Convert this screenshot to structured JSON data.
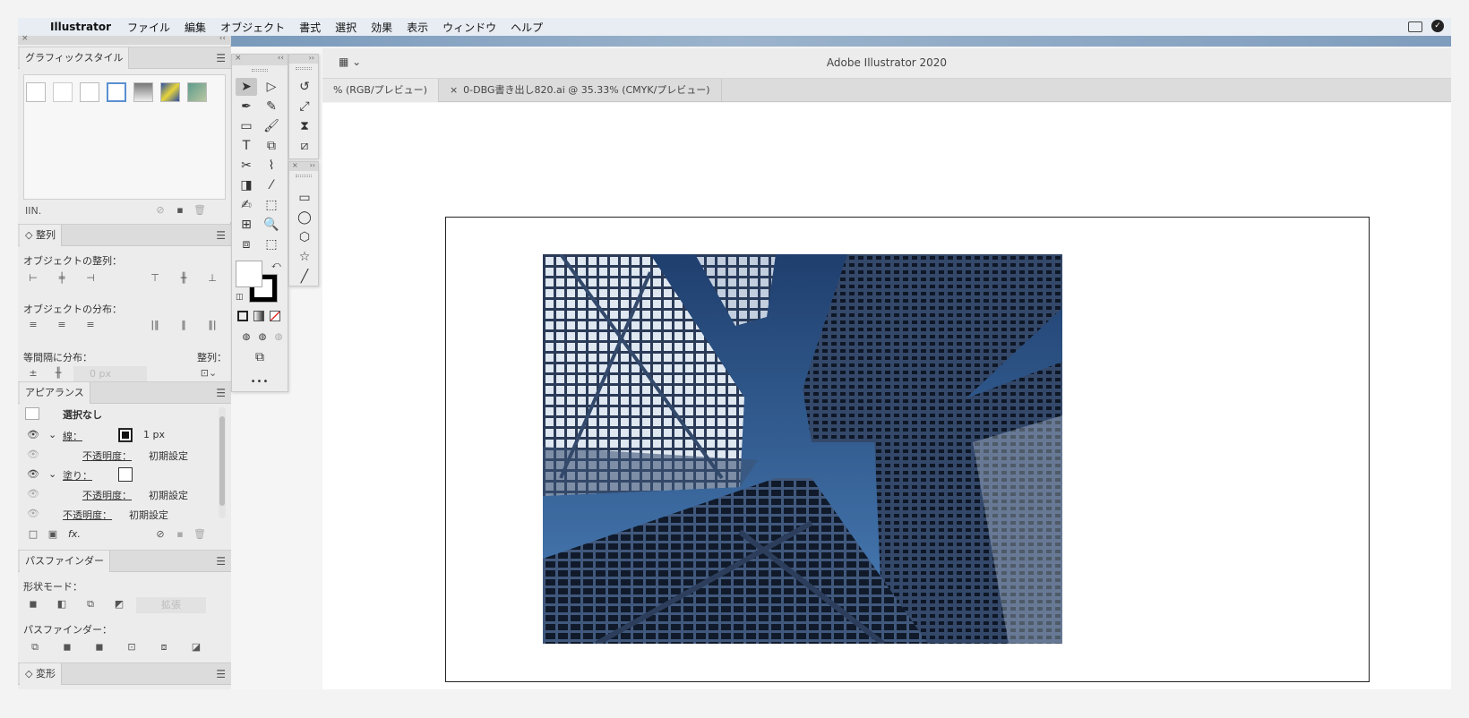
{
  "menubar": {
    "app_name": "Illustrator",
    "items": [
      "ファイル",
      "編集",
      "オブジェクト",
      "書式",
      "選択",
      "効果",
      "表示",
      "ウィンドウ",
      "ヘルプ"
    ]
  },
  "window": {
    "title": "Adobe Illustrator 2020",
    "tabs": [
      {
        "label": "% (RGB/プレビュー)"
      },
      {
        "label": "0-DBG書き出し820.ai @ 35.33% (CMYK/プレビュー)"
      }
    ]
  },
  "graphic_styles": {
    "tab": "グラフィックスタイル",
    "footer_menu": "IIN."
  },
  "align": {
    "tab": "整列",
    "align_objects_label": "オブジェクトの整列：",
    "distribute_objects_label": "オブジェクトの分布：",
    "distribute_spacing_label": "等間隔に分布：",
    "align_to_label": "整列：",
    "spacing_value": "0 px"
  },
  "appearance": {
    "tab": "アピアランス",
    "selection": "選択なし",
    "stroke_label": "線：",
    "stroke_value": "1 px",
    "opacity_label": "不透明度：",
    "opacity_value": "初期設定",
    "fill_label": "塗り：",
    "fill_opacity_label": "不透明度：",
    "fill_opacity_value": "初期設定",
    "object_opacity_label": "不透明度：",
    "object_opacity_value": "初期設定",
    "fx_label": "fx."
  },
  "pathfinder": {
    "tab": "パスファインダー",
    "shape_modes_label": "形状モード：",
    "expand_label": "拡張",
    "pathfinders_label": "パスファインダー："
  },
  "transform": {
    "tab": "変形"
  },
  "toolbar": {
    "more_label": "•••"
  },
  "colors": {
    "accent": "#1473e6",
    "sky": "#3b6ea8",
    "building": "#2c3e5c"
  }
}
